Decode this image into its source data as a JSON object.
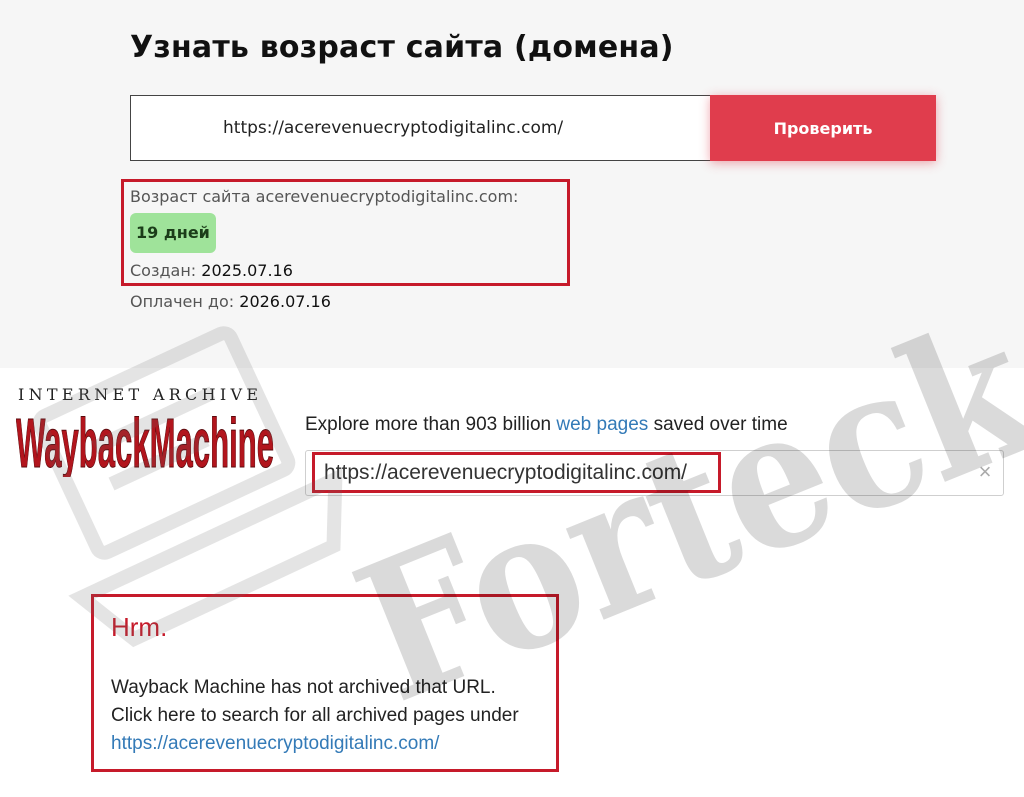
{
  "age_checker": {
    "title": "Узнать возраст сайта (домена)",
    "input_value": "https://acerevenuecryptodigitalinc.com/",
    "button_label": "Проверить",
    "result_label": "Возраст сайта acerevenuecryptodigitalinc.com:",
    "age_badge": "19 дней",
    "created_label": "Создан:",
    "created_value": "2025.07.16",
    "paid_label": "Оплачен до:",
    "paid_value": "2026.07.16"
  },
  "wayback": {
    "ia_text": "INTERNET ARCHIVE",
    "logo_text": "WaybackMachine",
    "explore_prefix": "Explore more than 903 billion",
    "explore_link": "web pages",
    "explore_suffix": "saved over time",
    "search_value": "https://acerevenuecryptodigitalinc.com/",
    "clear_icon": "×",
    "hrm_title": "Hrm.",
    "hrm_line1": "Wayback Machine has not archived that URL.",
    "hrm_line2": "Click here to search for all archived pages under",
    "hrm_link": "https://acerevenuecryptodigitalinc.com/"
  },
  "watermark": {
    "text": "Forteck"
  },
  "colors": {
    "accent_red": "#e03d4d",
    "highlight_border": "#c61a2a",
    "badge_green": "#9fe39a",
    "link_blue": "#337ab7",
    "wayback_red": "#b2151d"
  }
}
